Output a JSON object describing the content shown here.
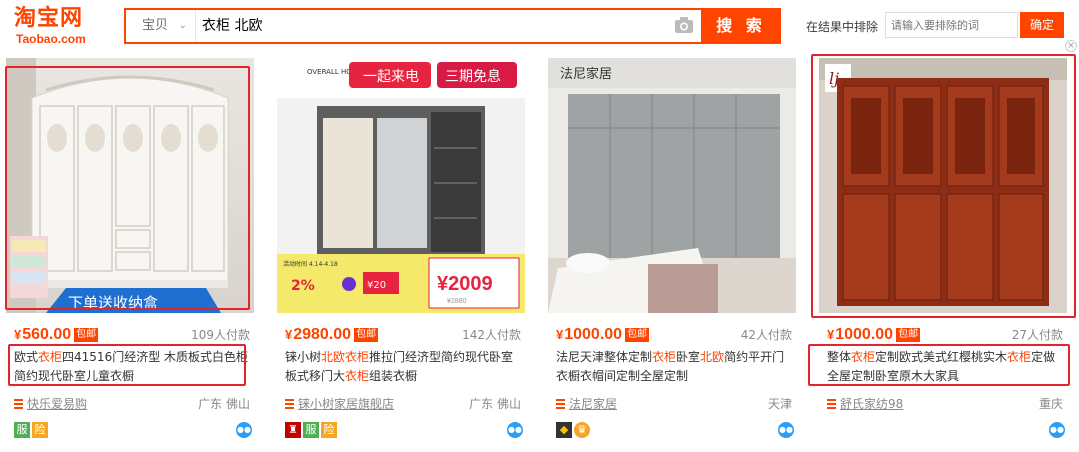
{
  "logo": {
    "cn": "淘宝网",
    "en": "Taobao.com"
  },
  "search": {
    "type": "宝贝",
    "query": "衣柜 北欧",
    "button": "搜 索"
  },
  "exclude": {
    "label": "在结果中排除",
    "placeholder": "请输入要排除的词",
    "button": "确定"
  },
  "baoyou_label": "包邮",
  "currency": "¥",
  "products": [
    {
      "price": "560.00",
      "paid": "109人付款",
      "title_parts": [
        {
          "t": "欧式"
        },
        {
          "t": "衣柜",
          "hl": true
        },
        {
          "t": "四41516门经济型 木质板式白色柜简约现代卧室儿童衣橱"
        }
      ],
      "shop": "快乐爱易购",
      "location": "广东 佛山",
      "badges": [
        "服",
        "险"
      ],
      "banner": "下单送收纳盒"
    },
    {
      "price": "2980.00",
      "paid": "142人付款",
      "title_parts": [
        {
          "t": "铼小树"
        },
        {
          "t": "北欧",
          "hl": true
        },
        {
          "t": "衣柜",
          "hl": true
        },
        {
          "t": "推拉门经济型简约现代卧室板式移门大"
        },
        {
          "t": "衣柜",
          "hl": true
        },
        {
          "t": "组装衣橱"
        }
      ],
      "shop": "铼小树家居旗舰店",
      "location": "广东 佛山",
      "badges": [
        "服",
        "险"
      ],
      "promo": {
        "brand": "OVERALL HOME DESIGN",
        "sale": "一起来电",
        "free": "三期免息",
        "dates": "活动时间 4.14-4.18",
        "discount": "2%",
        "coupon": "¥20",
        "final": "¥2009",
        "original": "¥2880"
      }
    },
    {
      "price": "1000.00",
      "paid": "42人付款",
      "title_parts": [
        {
          "t": "法尼天津整体定制"
        },
        {
          "t": "衣柜",
          "hl": true
        },
        {
          "t": "卧室"
        },
        {
          "t": "北欧",
          "hl": true
        },
        {
          "t": "简约平开门衣橱衣帽间定制全屋定制"
        }
      ],
      "shop": "法尼家居",
      "location": "天津",
      "badges": [],
      "brand_overlay": "法尼家居"
    },
    {
      "price": "1000.00",
      "paid": "27人付款",
      "title_parts": [
        {
          "t": "整体"
        },
        {
          "t": "衣柜",
          "hl": true
        },
        {
          "t": "定制欧式美式红樱桃实木"
        },
        {
          "t": "衣柜",
          "hl": true
        },
        {
          "t": "定做全屋定制卧室原木大家具"
        }
      ],
      "shop": "舒氏家纺98",
      "location": "重庆",
      "badges": [],
      "brand_overlay": "lj"
    }
  ],
  "colors": {
    "accent": "#ff4400",
    "highlight_box": "#e0262c",
    "wangwang": "#2b9ef5"
  }
}
